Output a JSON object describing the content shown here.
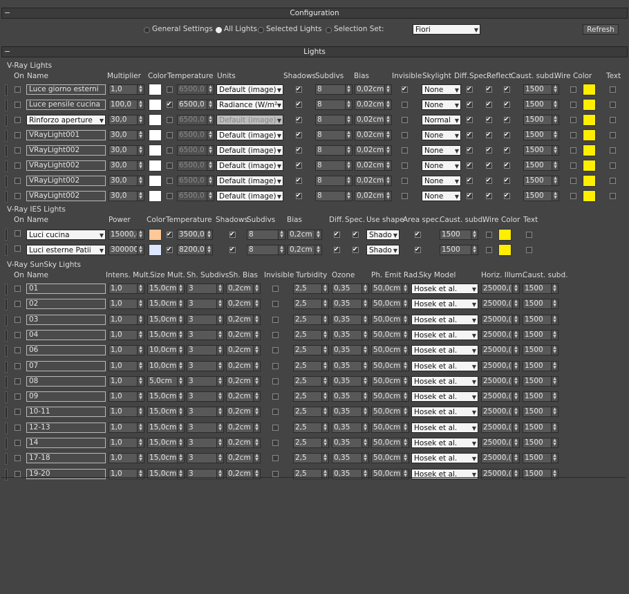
{
  "config": {
    "title": "Configuration",
    "options": [
      "General Settings",
      "All Lights",
      "Selected Lights",
      "Selection Set:"
    ],
    "selected_option": 1,
    "selection_set_value": "Fiori",
    "refresh_label": "Refresh"
  },
  "lights": {
    "title": "Lights",
    "vray": {
      "group_label": "V-Ray Lights",
      "headers": [
        "On",
        "Name",
        "Multiplier",
        "Color",
        "Temperature",
        "Units",
        "Shadows",
        "Subdivs",
        "Bias",
        "Invisible",
        "Skylight",
        "Diff.",
        "Spec.",
        "Reflect.",
        "Caust. subd.",
        "Wire Color",
        "Text"
      ],
      "rows": [
        {
          "name": "Luce giorno esterni",
          "name_dropdown": false,
          "multiplier": "1,0",
          "color": "#ffffff",
          "temp_on": false,
          "temperature": "6500,0",
          "units": "Default (image)",
          "units_disabled": false,
          "shadows": true,
          "subdivs": "8",
          "bias": "0,02cm",
          "invisible": true,
          "skylight": "None",
          "diff": true,
          "spec": true,
          "reflect": true,
          "caust": "1500",
          "wire": "#ffee00"
        },
        {
          "name": "Luce pensile cucina",
          "name_dropdown": false,
          "multiplier": "100,0",
          "color": "#ffffff",
          "temp_on": true,
          "temperature": "6500,0",
          "units": "Radiance (W/m²",
          "units_disabled": false,
          "shadows": true,
          "subdivs": "8",
          "bias": "0,02cm",
          "invisible": false,
          "skylight": "None",
          "diff": true,
          "spec": true,
          "reflect": true,
          "caust": "1500",
          "wire": "#ffee00"
        },
        {
          "name": "Rinforzo aperture",
          "name_dropdown": true,
          "multiplier": "30,0",
          "color": "#ffffff",
          "temp_on": false,
          "temperature": "6500,0",
          "units": "Default (image)",
          "units_disabled": true,
          "shadows": true,
          "subdivs": "8",
          "bias": "0,02cm",
          "invisible": false,
          "skylight": "Normal",
          "diff": true,
          "spec": true,
          "reflect": true,
          "caust": "1500",
          "wire": "#ffee00"
        },
        {
          "name": "VRayLight001",
          "name_dropdown": false,
          "multiplier": "30,0",
          "color": "#ffffff",
          "temp_on": false,
          "temperature": "6500,0",
          "units": "Default (image)",
          "units_disabled": false,
          "shadows": true,
          "subdivs": "8",
          "bias": "0,02cm",
          "invisible": false,
          "skylight": "None",
          "diff": true,
          "spec": true,
          "reflect": true,
          "caust": "1500",
          "wire": "#ffee00"
        },
        {
          "name": "VRayLight002",
          "name_dropdown": false,
          "multiplier": "30,0",
          "color": "#ffffff",
          "temp_on": false,
          "temperature": "6500,0",
          "units": "Default (image)",
          "units_disabled": false,
          "shadows": true,
          "subdivs": "8",
          "bias": "0,02cm",
          "invisible": false,
          "skylight": "None",
          "diff": true,
          "spec": true,
          "reflect": true,
          "caust": "1500",
          "wire": "#ffee00"
        },
        {
          "name": "VRayLight002",
          "name_dropdown": false,
          "multiplier": "30,0",
          "color": "#ffffff",
          "temp_on": false,
          "temperature": "6500,0",
          "units": "Default (image)",
          "units_disabled": false,
          "shadows": true,
          "subdivs": "8",
          "bias": "0,02cm",
          "invisible": false,
          "skylight": "None",
          "diff": true,
          "spec": true,
          "reflect": true,
          "caust": "1500",
          "wire": "#ffee00"
        },
        {
          "name": "VRayLight002",
          "name_dropdown": false,
          "multiplier": "30,0",
          "color": "#ffffff",
          "temp_on": false,
          "temperature": "6500,0",
          "units": "Default (image)",
          "units_disabled": false,
          "shadows": true,
          "subdivs": "8",
          "bias": "0,02cm",
          "invisible": false,
          "skylight": "None",
          "diff": true,
          "spec": true,
          "reflect": true,
          "caust": "1500",
          "wire": "#ffee00"
        },
        {
          "name": "VRayLight002",
          "name_dropdown": false,
          "multiplier": "30,0",
          "color": "#ffffff",
          "temp_on": false,
          "temperature": "6500,0",
          "units": "Default (image)",
          "units_disabled": false,
          "shadows": true,
          "subdivs": "8",
          "bias": "0,02cm",
          "invisible": false,
          "skylight": "None",
          "diff": true,
          "spec": true,
          "reflect": true,
          "caust": "1500",
          "wire": "#ffee00"
        }
      ]
    },
    "ies": {
      "group_label": "V-Ray IES Lights",
      "headers": [
        "On",
        "Name",
        "Power",
        "Color",
        "Temperature",
        "Shadows",
        "Subdivs",
        "Bias",
        "Diff.",
        "Spec.",
        "Use shape",
        "Area spec.",
        "Caust. subd.",
        "Wire Color",
        "Text"
      ],
      "rows": [
        {
          "name": "Luci cucina",
          "power": "15000,(",
          "color": "#ffc896",
          "temp_on": true,
          "temperature": "3500,0",
          "shadows": true,
          "subdivs": "8",
          "bias": "0,2cm",
          "diff": true,
          "spec": true,
          "use_shape": "Shado",
          "area_spec": true,
          "caust": "1500",
          "wire": "#ffee00"
        },
        {
          "name": "Luci esterne Patii",
          "power": "300000",
          "color": "#dce6ff",
          "temp_on": true,
          "temperature": "8200,0",
          "shadows": true,
          "subdivs": "8",
          "bias": "0,2cm",
          "diff": true,
          "spec": true,
          "use_shape": "Shado",
          "area_spec": true,
          "caust": "1500",
          "wire": "#ffee00"
        }
      ]
    },
    "sunsky": {
      "group_label": "V-Ray SunSky Lights",
      "headers": [
        "On",
        "Name",
        "Intens. Mult.",
        "Size Mult.",
        "Sh. Subdivs",
        "Sh. Bias",
        "Invisible",
        "Turbidity",
        "Ozone",
        "Ph. Emit Rad.",
        "Sky Model",
        "Horiz. Illum.",
        "Caust. subd."
      ],
      "rows": [
        {
          "name": "01",
          "intens": "1,0",
          "size": "15,0cm",
          "subdivs": "3",
          "bias": "0,2cm",
          "turbidity": "2,5",
          "ozone": "0,35",
          "emit": "50,0cm",
          "model": "Hosek et al.",
          "horiz": "25000,(",
          "caust": "1500"
        },
        {
          "name": "02",
          "intens": "1,0",
          "size": "15,0cm",
          "subdivs": "3",
          "bias": "0,2cm",
          "turbidity": "2,5",
          "ozone": "0,35",
          "emit": "50,0cm",
          "model": "Hosek et al.",
          "horiz": "25000,(",
          "caust": "1500"
        },
        {
          "name": "03",
          "intens": "1,0",
          "size": "15,0cm",
          "subdivs": "3",
          "bias": "0,2cm",
          "turbidity": "2,5",
          "ozone": "0,35",
          "emit": "50,0cm",
          "model": "Hosek et al.",
          "horiz": "25000,(",
          "caust": "1500"
        },
        {
          "name": "04",
          "intens": "1,0",
          "size": "15,0cm",
          "subdivs": "3",
          "bias": "0,2cm",
          "turbidity": "2,5",
          "ozone": "0,35",
          "emit": "50,0cm",
          "model": "Hosek et al.",
          "horiz": "25000,(",
          "caust": "1500"
        },
        {
          "name": "06",
          "intens": "1,0",
          "size": "10,0cm",
          "subdivs": "3",
          "bias": "0,2cm",
          "turbidity": "2,5",
          "ozone": "0,35",
          "emit": "50,0cm",
          "model": "Hosek et al.",
          "horiz": "25000,(",
          "caust": "1500"
        },
        {
          "name": "07",
          "intens": "1,0",
          "size": "10,0cm",
          "subdivs": "3",
          "bias": "0,2cm",
          "turbidity": "2,5",
          "ozone": "0,35",
          "emit": "50,0cm",
          "model": "Hosek et al.",
          "horiz": "25000,(",
          "caust": "1500"
        },
        {
          "name": "08",
          "intens": "1,0",
          "size": "5,0cm",
          "subdivs": "3",
          "bias": "0,2cm",
          "turbidity": "2,5",
          "ozone": "0,35",
          "emit": "50,0cm",
          "model": "Hosek et al.",
          "horiz": "25000,(",
          "caust": "1500"
        },
        {
          "name": "09",
          "intens": "1,0",
          "size": "15,0cm",
          "subdivs": "3",
          "bias": "0,2cm",
          "turbidity": "2,5",
          "ozone": "0,35",
          "emit": "50,0cm",
          "model": "Hosek et al.",
          "horiz": "25000,(",
          "caust": "1500"
        },
        {
          "name": "10-11",
          "intens": "1,0",
          "size": "15,0cm",
          "subdivs": "3",
          "bias": "0,2cm",
          "turbidity": "2,5",
          "ozone": "0,35",
          "emit": "50,0cm",
          "model": "Hosek et al.",
          "horiz": "25000,(",
          "caust": "1500"
        },
        {
          "name": "12-13",
          "intens": "1,0",
          "size": "15,0cm",
          "subdivs": "3",
          "bias": "0,2cm",
          "turbidity": "2,5",
          "ozone": "0,35",
          "emit": "50,0cm",
          "model": "Hosek et al.",
          "horiz": "25000,(",
          "caust": "1500"
        },
        {
          "name": "14",
          "intens": "1,0",
          "size": "15,0cm",
          "subdivs": "3",
          "bias": "0,2cm",
          "turbidity": "2,5",
          "ozone": "0,35",
          "emit": "50,0cm",
          "model": "Hosek et al.",
          "horiz": "25000,(",
          "caust": "1500"
        },
        {
          "name": "17-18",
          "intens": "1,0",
          "size": "15,0cm",
          "subdivs": "3",
          "bias": "0,2cm",
          "turbidity": "2,5",
          "ozone": "0,35",
          "emit": "50,0cm",
          "model": "Hosek et al.",
          "horiz": "25000,(",
          "caust": "1500"
        },
        {
          "name": "19-20",
          "intens": "1,0",
          "size": "15,0cm",
          "subdivs": "3",
          "bias": "0,2cm",
          "turbidity": "2,5",
          "ozone": "0,35",
          "emit": "50,0cm",
          "model": "Hosek et al.",
          "horiz": "25000,(",
          "caust": "1500"
        }
      ]
    }
  }
}
